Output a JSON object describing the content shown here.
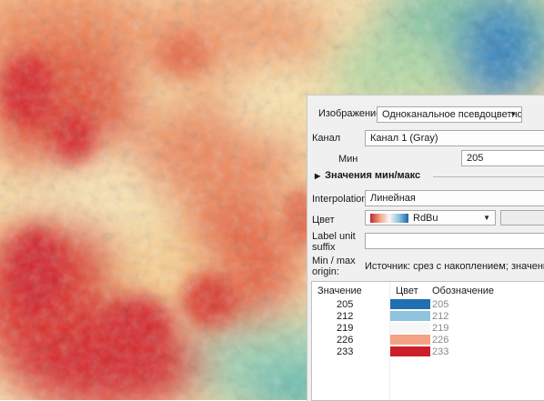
{
  "map": {
    "description_icon": "elevation-raster",
    "colors": {
      "high": "#d42a2a",
      "mid_high": "#f08a60",
      "mid": "#fbd79e",
      "light": "#fff5c8",
      "mid_low": "#b8dfa8",
      "low_teal": "#6fc2a8",
      "lowest": "#2e83c2"
    }
  },
  "panel": {
    "render_type_label": "Изображение",
    "render_type_value": "Одноканальное псевдоцветное",
    "band_label": "Канал",
    "band_value": "Канал 1 (Gray)",
    "min_label": "Мин",
    "min_value": "205",
    "minmax_section": "Значения мин/макс",
    "interpolation_label": "Interpolation",
    "interpolation_value": "Линейная",
    "color_label": "Цвет",
    "color_ramp_name": "RdBu",
    "label_unit_label_1": "Label unit",
    "label_unit_label_2": "suffix",
    "label_unit_value": "",
    "minmax_origin_label_1": "Min / max",
    "minmax_origin_label_2": "origin:",
    "minmax_origin_value": "Источник: срез с накоплением; значения: р",
    "table": {
      "headers": [
        "Значение",
        "Цвет",
        "Обозначение"
      ],
      "rows": [
        {
          "value": "205",
          "color": "#1f6fb3",
          "label": "205"
        },
        {
          "value": "212",
          "color": "#8fc3de",
          "label": "212"
        },
        {
          "value": "219",
          "color": "#f7f7f7",
          "label": "219"
        },
        {
          "value": "226",
          "color": "#f4a283",
          "label": "226"
        },
        {
          "value": "233",
          "color": "#cc1f2a",
          "label": "233"
        }
      ]
    }
  }
}
